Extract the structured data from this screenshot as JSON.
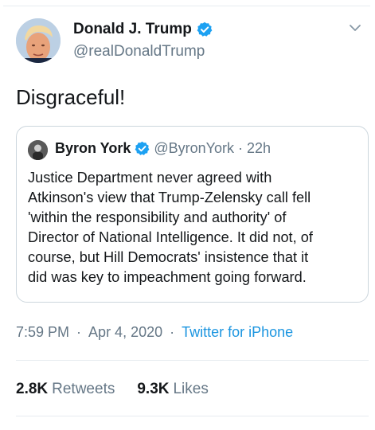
{
  "author": {
    "name": "Donald J. Trump",
    "handle": "@realDonaldTrump",
    "verified": true,
    "avatar_icon": "profile-photo",
    "options_icon": "chevron-down-icon"
  },
  "tweet": {
    "text": "Disgraceful!"
  },
  "quoted_tweet": {
    "name": "Byron York",
    "handle": "@ByronYork",
    "separator": "·",
    "time": "22h",
    "verified": true,
    "lines": [
      "Justice Department never agreed with",
      "Atkinson's view that Trump-Zelensky call fell",
      "'within the responsibility and authority' of",
      "Director of National Intelligence. It did not, of",
      "course, but Hill Democrats' insistence that it",
      "did was key to impeachment going forward."
    ]
  },
  "meta": {
    "time": "7:59 PM",
    "separator": "·",
    "date": "Apr 4, 2020",
    "source": "Twitter for iPhone"
  },
  "stats": {
    "retweets_count": "2.8K",
    "retweets_label": "Retweets",
    "likes_count": "9.3K",
    "likes_label": "Likes"
  },
  "colors": {
    "verified_blue": "#1da1f2",
    "link_blue": "#1b95e0",
    "secondary_text": "#657786",
    "border": "#ccd6dd"
  }
}
